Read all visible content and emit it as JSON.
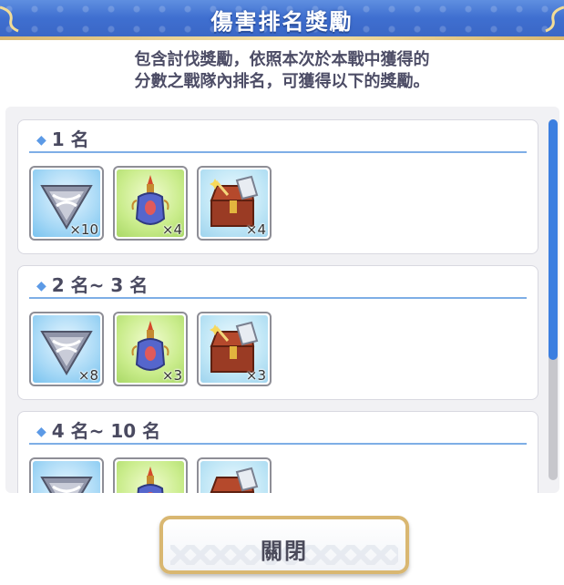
{
  "header": {
    "title": "傷害排名獎勵"
  },
  "description": {
    "line1": "包含討伐獎勵，依照本次於本戰中獲得的",
    "line2": "分數之戰隊內排名，可獲得以下的獎勵。"
  },
  "tiers": [
    {
      "rank": "1 名",
      "items": [
        {
          "icon": "crystal-icon",
          "qty": "×10"
        },
        {
          "icon": "potion-icon",
          "qty": "×4"
        },
        {
          "icon": "treasure-chest-icon",
          "qty": "×4"
        }
      ]
    },
    {
      "rank": "2 名~ 3 名",
      "items": [
        {
          "icon": "crystal-icon",
          "qty": "×8"
        },
        {
          "icon": "potion-icon",
          "qty": "×3"
        },
        {
          "icon": "treasure-chest-icon",
          "qty": "×3"
        }
      ]
    },
    {
      "rank": "4 名~ 10 名",
      "items": [
        {
          "icon": "crystal-icon",
          "qty": ""
        },
        {
          "icon": "potion-icon",
          "qty": ""
        },
        {
          "icon": "treasure-chest-icon",
          "qty": ""
        }
      ]
    }
  ],
  "close_button": {
    "label": "關閉"
  },
  "colors": {
    "header_blue": "#3f6fd0",
    "accent_gold": "#d9b771",
    "scroll_thumb": "#3b7ee0"
  }
}
